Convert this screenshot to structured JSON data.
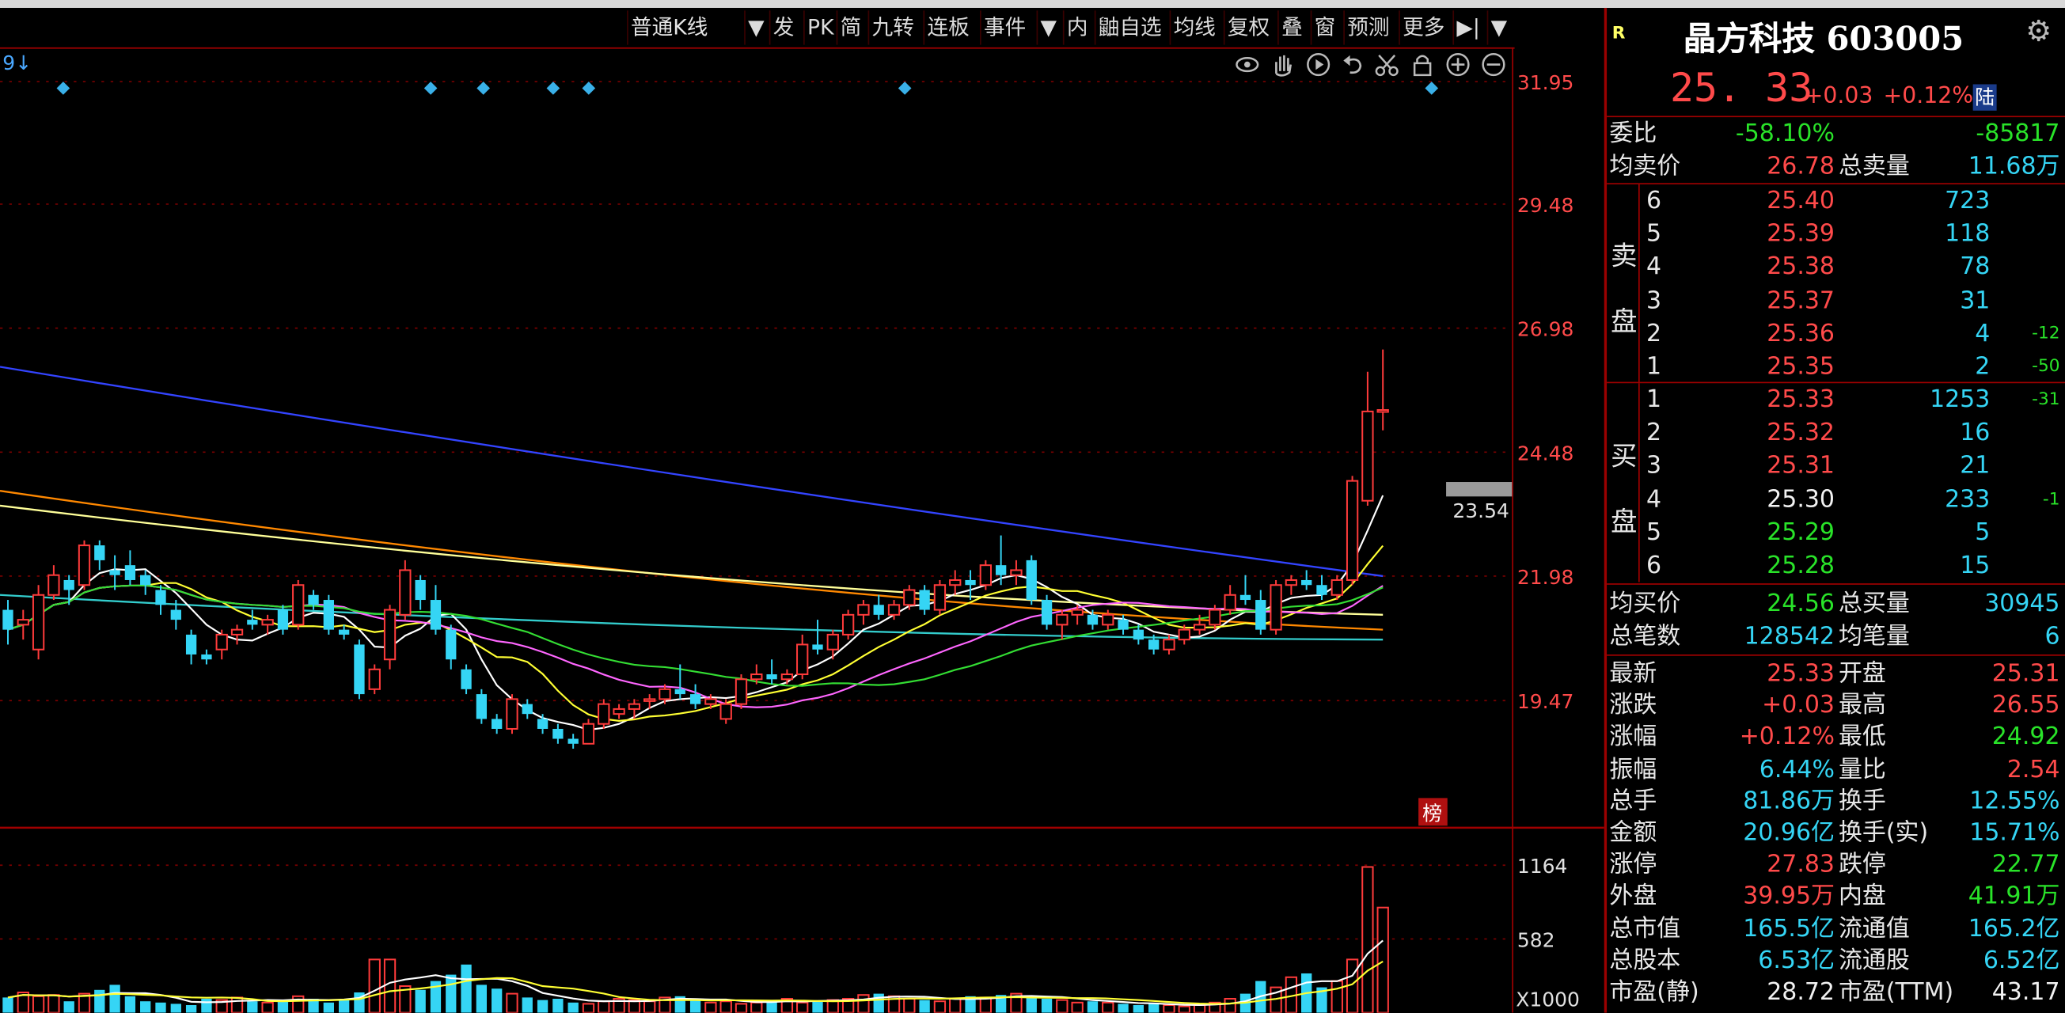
{
  "toolbar": {
    "items": [
      "普通K线",
      "▼",
      "发",
      "PK",
      "简",
      "九转",
      "连板",
      "事件",
      "▼",
      "内",
      "鼬自选",
      "均线",
      "复权",
      "叠",
      "窗",
      "预测",
      "更多",
      "▶|",
      "▼"
    ]
  },
  "chart_icons": [
    "eye-icon",
    "hand-icon",
    "play-icon",
    "undo-icon",
    "scissors-icon",
    "lock-icon",
    "zoom-in-icon",
    "zoom-out-icon"
  ],
  "chart_corner_label": "9↓",
  "board_label": "榜",
  "current_price_tag": "23.54",
  "chart_data": [
    {
      "type": "candlestick",
      "title": "",
      "y_ticks": [
        "31.95",
        "29.48",
        "26.98",
        "24.48",
        "21.98",
        "19.47"
      ],
      "ylim": [
        18.0,
        32.5
      ],
      "candles": [
        {
          "o": 21.3,
          "h": 21.5,
          "l": 20.6,
          "c": 20.9
        },
        {
          "o": 21.0,
          "h": 21.3,
          "l": 20.7,
          "c": 21.1
        },
        {
          "o": 20.5,
          "h": 21.8,
          "l": 20.3,
          "c": 21.6
        },
        {
          "o": 21.6,
          "h": 22.2,
          "l": 21.5,
          "c": 22.0
        },
        {
          "o": 21.9,
          "h": 22.0,
          "l": 21.4,
          "c": 21.7
        },
        {
          "o": 21.8,
          "h": 22.7,
          "l": 21.7,
          "c": 22.6
        },
        {
          "o": 22.6,
          "h": 22.7,
          "l": 22.1,
          "c": 22.3
        },
        {
          "o": 22.1,
          "h": 22.4,
          "l": 21.7,
          "c": 22.0
        },
        {
          "o": 22.2,
          "h": 22.5,
          "l": 21.8,
          "c": 21.9
        },
        {
          "o": 22.0,
          "h": 22.1,
          "l": 21.6,
          "c": 21.8
        },
        {
          "o": 21.7,
          "h": 21.8,
          "l": 21.2,
          "c": 21.4
        },
        {
          "o": 21.3,
          "h": 21.5,
          "l": 20.9,
          "c": 21.1
        },
        {
          "o": 20.8,
          "h": 20.9,
          "l": 20.2,
          "c": 20.4
        },
        {
          "o": 20.4,
          "h": 20.5,
          "l": 20.2,
          "c": 20.3
        },
        {
          "o": 20.5,
          "h": 20.9,
          "l": 20.3,
          "c": 20.8
        },
        {
          "o": 20.8,
          "h": 21.0,
          "l": 20.6,
          "c": 20.9
        },
        {
          "o": 21.1,
          "h": 21.3,
          "l": 20.9,
          "c": 21.0
        },
        {
          "o": 21.0,
          "h": 21.2,
          "l": 20.8,
          "c": 21.1
        },
        {
          "o": 21.3,
          "h": 21.4,
          "l": 20.8,
          "c": 20.9
        },
        {
          "o": 21.0,
          "h": 21.9,
          "l": 20.9,
          "c": 21.8
        },
        {
          "o": 21.6,
          "h": 21.7,
          "l": 21.3,
          "c": 21.4
        },
        {
          "o": 21.5,
          "h": 21.6,
          "l": 20.8,
          "c": 20.9
        },
        {
          "o": 20.9,
          "h": 21.0,
          "l": 20.7,
          "c": 20.8
        },
        {
          "o": 20.6,
          "h": 20.7,
          "l": 19.5,
          "c": 19.6
        },
        {
          "o": 19.7,
          "h": 20.2,
          "l": 19.6,
          "c": 20.1
        },
        {
          "o": 20.3,
          "h": 21.4,
          "l": 20.1,
          "c": 21.3
        },
        {
          "o": 21.2,
          "h": 22.3,
          "l": 21.1,
          "c": 22.1
        },
        {
          "o": 21.9,
          "h": 22.0,
          "l": 21.3,
          "c": 21.5
        },
        {
          "o": 21.5,
          "h": 21.8,
          "l": 20.8,
          "c": 20.9
        },
        {
          "o": 20.9,
          "h": 21.0,
          "l": 20.1,
          "c": 20.3
        },
        {
          "o": 20.1,
          "h": 20.2,
          "l": 19.6,
          "c": 19.7
        },
        {
          "o": 19.6,
          "h": 19.7,
          "l": 19.0,
          "c": 19.1
        },
        {
          "o": 19.1,
          "h": 19.2,
          "l": 18.8,
          "c": 18.9
        },
        {
          "o": 18.9,
          "h": 19.6,
          "l": 18.8,
          "c": 19.5
        },
        {
          "o": 19.4,
          "h": 19.5,
          "l": 19.1,
          "c": 19.2
        },
        {
          "o": 19.1,
          "h": 19.2,
          "l": 18.8,
          "c": 18.9
        },
        {
          "o": 18.9,
          "h": 19.0,
          "l": 18.6,
          "c": 18.7
        },
        {
          "o": 18.7,
          "h": 18.8,
          "l": 18.5,
          "c": 18.6
        },
        {
          "o": 18.6,
          "h": 19.1,
          "l": 18.6,
          "c": 19.0
        },
        {
          "o": 19.0,
          "h": 19.5,
          "l": 18.9,
          "c": 19.4
        },
        {
          "o": 19.2,
          "h": 19.4,
          "l": 19.1,
          "c": 19.3
        },
        {
          "o": 19.3,
          "h": 19.5,
          "l": 19.1,
          "c": 19.4
        },
        {
          "o": 19.5,
          "h": 19.6,
          "l": 19.3,
          "c": 19.5
        },
        {
          "o": 19.5,
          "h": 19.8,
          "l": 19.4,
          "c": 19.7
        },
        {
          "o": 19.7,
          "h": 20.2,
          "l": 19.5,
          "c": 19.6
        },
        {
          "o": 19.6,
          "h": 19.8,
          "l": 19.3,
          "c": 19.4
        },
        {
          "o": 19.4,
          "h": 19.6,
          "l": 19.3,
          "c": 19.5
        },
        {
          "o": 19.1,
          "h": 19.5,
          "l": 19.0,
          "c": 19.4
        },
        {
          "o": 19.4,
          "h": 20.0,
          "l": 19.3,
          "c": 19.9
        },
        {
          "o": 19.9,
          "h": 20.2,
          "l": 19.8,
          "c": 20.0
        },
        {
          "o": 20.0,
          "h": 20.3,
          "l": 19.8,
          "c": 19.9
        },
        {
          "o": 19.9,
          "h": 20.1,
          "l": 19.8,
          "c": 20.0
        },
        {
          "o": 20.0,
          "h": 20.8,
          "l": 19.9,
          "c": 20.6
        },
        {
          "o": 20.6,
          "h": 21.1,
          "l": 20.4,
          "c": 20.5
        },
        {
          "o": 20.5,
          "h": 20.9,
          "l": 20.3,
          "c": 20.8
        },
        {
          "o": 20.8,
          "h": 21.3,
          "l": 20.7,
          "c": 21.2
        },
        {
          "o": 21.2,
          "h": 21.5,
          "l": 21.0,
          "c": 21.4
        },
        {
          "o": 21.4,
          "h": 21.6,
          "l": 21.1,
          "c": 21.2
        },
        {
          "o": 21.2,
          "h": 21.5,
          "l": 21.1,
          "c": 21.4
        },
        {
          "o": 21.4,
          "h": 21.8,
          "l": 21.3,
          "c": 21.7
        },
        {
          "o": 21.7,
          "h": 21.8,
          "l": 21.2,
          "c": 21.3
        },
        {
          "o": 21.3,
          "h": 21.9,
          "l": 21.2,
          "c": 21.8
        },
        {
          "o": 21.8,
          "h": 22.1,
          "l": 21.6,
          "c": 21.9
        },
        {
          "o": 21.9,
          "h": 22.1,
          "l": 21.5,
          "c": 21.8
        },
        {
          "o": 21.8,
          "h": 22.3,
          "l": 21.7,
          "c": 22.2
        },
        {
          "o": 22.2,
          "h": 22.8,
          "l": 21.8,
          "c": 22.0
        },
        {
          "o": 22.0,
          "h": 22.3,
          "l": 21.8,
          "c": 22.1
        },
        {
          "o": 22.3,
          "h": 22.4,
          "l": 21.4,
          "c": 21.5
        },
        {
          "o": 21.5,
          "h": 21.6,
          "l": 20.9,
          "c": 21.0
        },
        {
          "o": 21.0,
          "h": 21.3,
          "l": 20.7,
          "c": 21.2
        },
        {
          "o": 21.2,
          "h": 21.4,
          "l": 21.0,
          "c": 21.3
        },
        {
          "o": 21.2,
          "h": 21.3,
          "l": 20.9,
          "c": 21.0
        },
        {
          "o": 21.0,
          "h": 21.3,
          "l": 20.9,
          "c": 21.2
        },
        {
          "o": 21.1,
          "h": 21.2,
          "l": 20.8,
          "c": 20.9
        },
        {
          "o": 20.9,
          "h": 21.0,
          "l": 20.6,
          "c": 20.7
        },
        {
          "o": 20.7,
          "h": 20.8,
          "l": 20.4,
          "c": 20.5
        },
        {
          "o": 20.5,
          "h": 20.8,
          "l": 20.4,
          "c": 20.7
        },
        {
          "o": 20.7,
          "h": 21.0,
          "l": 20.6,
          "c": 20.9
        },
        {
          "o": 20.9,
          "h": 21.2,
          "l": 20.8,
          "c": 21.0
        },
        {
          "o": 21.0,
          "h": 21.4,
          "l": 20.9,
          "c": 21.3
        },
        {
          "o": 21.3,
          "h": 21.8,
          "l": 21.2,
          "c": 21.6
        },
        {
          "o": 21.6,
          "h": 22.0,
          "l": 21.4,
          "c": 21.5
        },
        {
          "o": 21.5,
          "h": 21.7,
          "l": 20.8,
          "c": 20.9
        },
        {
          "o": 20.9,
          "h": 21.9,
          "l": 20.8,
          "c": 21.8
        },
        {
          "o": 21.8,
          "h": 22.0,
          "l": 21.6,
          "c": 21.9
        },
        {
          "o": 21.9,
          "h": 22.1,
          "l": 21.7,
          "c": 21.8
        },
        {
          "o": 21.8,
          "h": 22.0,
          "l": 21.5,
          "c": 21.6
        },
        {
          "o": 21.6,
          "h": 22.0,
          "l": 21.5,
          "c": 21.9
        },
        {
          "o": 21.9,
          "h": 24.0,
          "l": 21.8,
          "c": 23.9
        },
        {
          "o": 23.5,
          "h": 26.1,
          "l": 23.4,
          "c": 25.3
        },
        {
          "o": 25.31,
          "h": 26.55,
          "l": 24.92,
          "c": 25.33
        }
      ],
      "ma_lines": [
        {
          "color": "#ffffff",
          "period": 5
        },
        {
          "color": "#ffff33",
          "period": 10
        },
        {
          "color": "#ff66ff",
          "period": 20
        },
        {
          "color": "#33dd33",
          "period": 30
        },
        {
          "color": "#33cccc",
          "period": 60
        },
        {
          "color": "#ff8800",
          "period": 120
        },
        {
          "color": "#ffff99",
          "period": 180
        },
        {
          "color": "#3344ff",
          "period": 250
        }
      ],
      "long_ma": {
        "blue": [
          26.2,
          21.98
        ],
        "orange": [
          23.7,
          20.9
        ],
        "beige": [
          23.4,
          21.2
        ],
        "cyan": [
          21.6,
          20.7
        ]
      }
    },
    {
      "type": "bar",
      "title": "",
      "y_ticks": [
        "1164",
        "582"
      ],
      "unit_label": "X1000",
      "ylim": [
        0,
        1250
      ],
      "values": [
        120,
        160,
        130,
        140,
        90,
        150,
        180,
        220,
        130,
        90,
        80,
        70,
        60,
        110,
        100,
        120,
        90,
        80,
        100,
        130,
        110,
        80,
        100,
        160,
        420,
        420,
        210,
        180,
        250,
        300,
        380,
        220,
        190,
        150,
        120,
        100,
        110,
        80,
        70,
        90,
        110,
        100,
        90,
        120,
        130,
        100,
        80,
        90,
        70,
        80,
        100,
        110,
        80,
        90,
        100,
        110,
        140,
        150,
        130,
        110,
        100,
        90,
        110,
        130,
        120,
        140,
        150,
        120,
        110,
        100,
        80,
        90,
        80,
        70,
        60,
        70,
        60,
        50,
        60,
        80,
        110,
        150,
        250,
        200,
        280,
        310,
        200,
        250,
        420,
        1150,
        830
      ],
      "ma5_color": "#ffffff",
      "ma10_color": "#ffff33"
    }
  ],
  "stock": {
    "name": "晶方科技 603005",
    "r_mark": "R",
    "price": "25. 33",
    "change": "+0.03",
    "change_pct": "+0.12%",
    "market_tag": "陆"
  },
  "weibi": {
    "label": "委比",
    "pct": "-58.10%",
    "diff": "-85817"
  },
  "sell_avg": {
    "label": "均卖价",
    "price": "26.78",
    "total_label": "总卖量",
    "total": "11.68万"
  },
  "sell_side_label": [
    "卖",
    "盘"
  ],
  "buy_side_label": [
    "买",
    "盘"
  ],
  "asks": [
    {
      "lvl": "6",
      "price": "25.40",
      "vol": "723",
      "chg": ""
    },
    {
      "lvl": "5",
      "price": "25.39",
      "vol": "118",
      "chg": ""
    },
    {
      "lvl": "4",
      "price": "25.38",
      "vol": "78",
      "chg": ""
    },
    {
      "lvl": "3",
      "price": "25.37",
      "vol": "31",
      "chg": ""
    },
    {
      "lvl": "2",
      "price": "25.36",
      "vol": "4",
      "chg": "-12"
    },
    {
      "lvl": "1",
      "price": "25.35",
      "vol": "2",
      "chg": "-50"
    }
  ],
  "bids": [
    {
      "lvl": "1",
      "price": "25.33",
      "vol": "1253",
      "chg": "-31",
      "pc": "red"
    },
    {
      "lvl": "2",
      "price": "25.32",
      "vol": "16",
      "chg": "",
      "pc": "red"
    },
    {
      "lvl": "3",
      "price": "25.31",
      "vol": "21",
      "chg": "",
      "pc": "red"
    },
    {
      "lvl": "4",
      "price": "25.30",
      "vol": "233",
      "chg": "-1",
      "pc": "wht"
    },
    {
      "lvl": "5",
      "price": "25.29",
      "vol": "5",
      "chg": "",
      "pc": "grn"
    },
    {
      "lvl": "6",
      "price": "25.28",
      "vol": "15",
      "chg": "",
      "pc": "grn"
    }
  ],
  "buy_avg": {
    "label": "均买价",
    "price": "24.56",
    "total_label": "总买量",
    "total": "30945"
  },
  "trades": {
    "label": "总笔数",
    "value": "128542",
    "avg_label": "均笔量",
    "avg": "6"
  },
  "stats": [
    {
      "l1": "最新",
      "v1": "25.33",
      "c1": "red",
      "l2": "开盘",
      "v2": "25.31",
      "c2": "red"
    },
    {
      "l1": "涨跌",
      "v1": "+0.03",
      "c1": "red",
      "l2": "最高",
      "v2": "26.55",
      "c2": "red"
    },
    {
      "l1": "涨幅",
      "v1": "+0.12%",
      "c1": "red",
      "l2": "最低",
      "v2": "24.92",
      "c2": "grn"
    },
    {
      "l1": "振幅",
      "v1": "6.44%",
      "c1": "cyn",
      "l2": "量比",
      "v2": "2.54",
      "c2": "red"
    },
    {
      "l1": "总手",
      "v1": "81.86万",
      "c1": "cyn",
      "l2": "换手",
      "v2": "12.55%",
      "c2": "cyn"
    },
    {
      "l1": "金额",
      "v1": "20.96亿",
      "c1": "cyn",
      "l2": "换手(实)",
      "v2": "15.71%",
      "c2": "cyn"
    },
    {
      "l1": "涨停",
      "v1": "27.83",
      "c1": "red",
      "l2": "跌停",
      "v2": "22.77",
      "c2": "grn"
    },
    {
      "l1": "外盘",
      "v1": "39.95万",
      "c1": "red",
      "l2": "内盘",
      "v2": "41.91万",
      "c2": "grn"
    },
    {
      "l1": "总市值",
      "v1": "165.5亿",
      "c1": "cyn",
      "l2": "流通值",
      "v2": "165.2亿",
      "c2": "cyn"
    },
    {
      "l1": "总股本",
      "v1": "6.53亿",
      "c1": "cyn",
      "l2": "流通股",
      "v2": "6.52亿",
      "c2": "cyn"
    },
    {
      "l1": "市盈(静)",
      "v1": "28.72",
      "c1": "wht",
      "l2": "市盈(TTM)",
      "v2": "43.17",
      "c2": "wht"
    }
  ]
}
